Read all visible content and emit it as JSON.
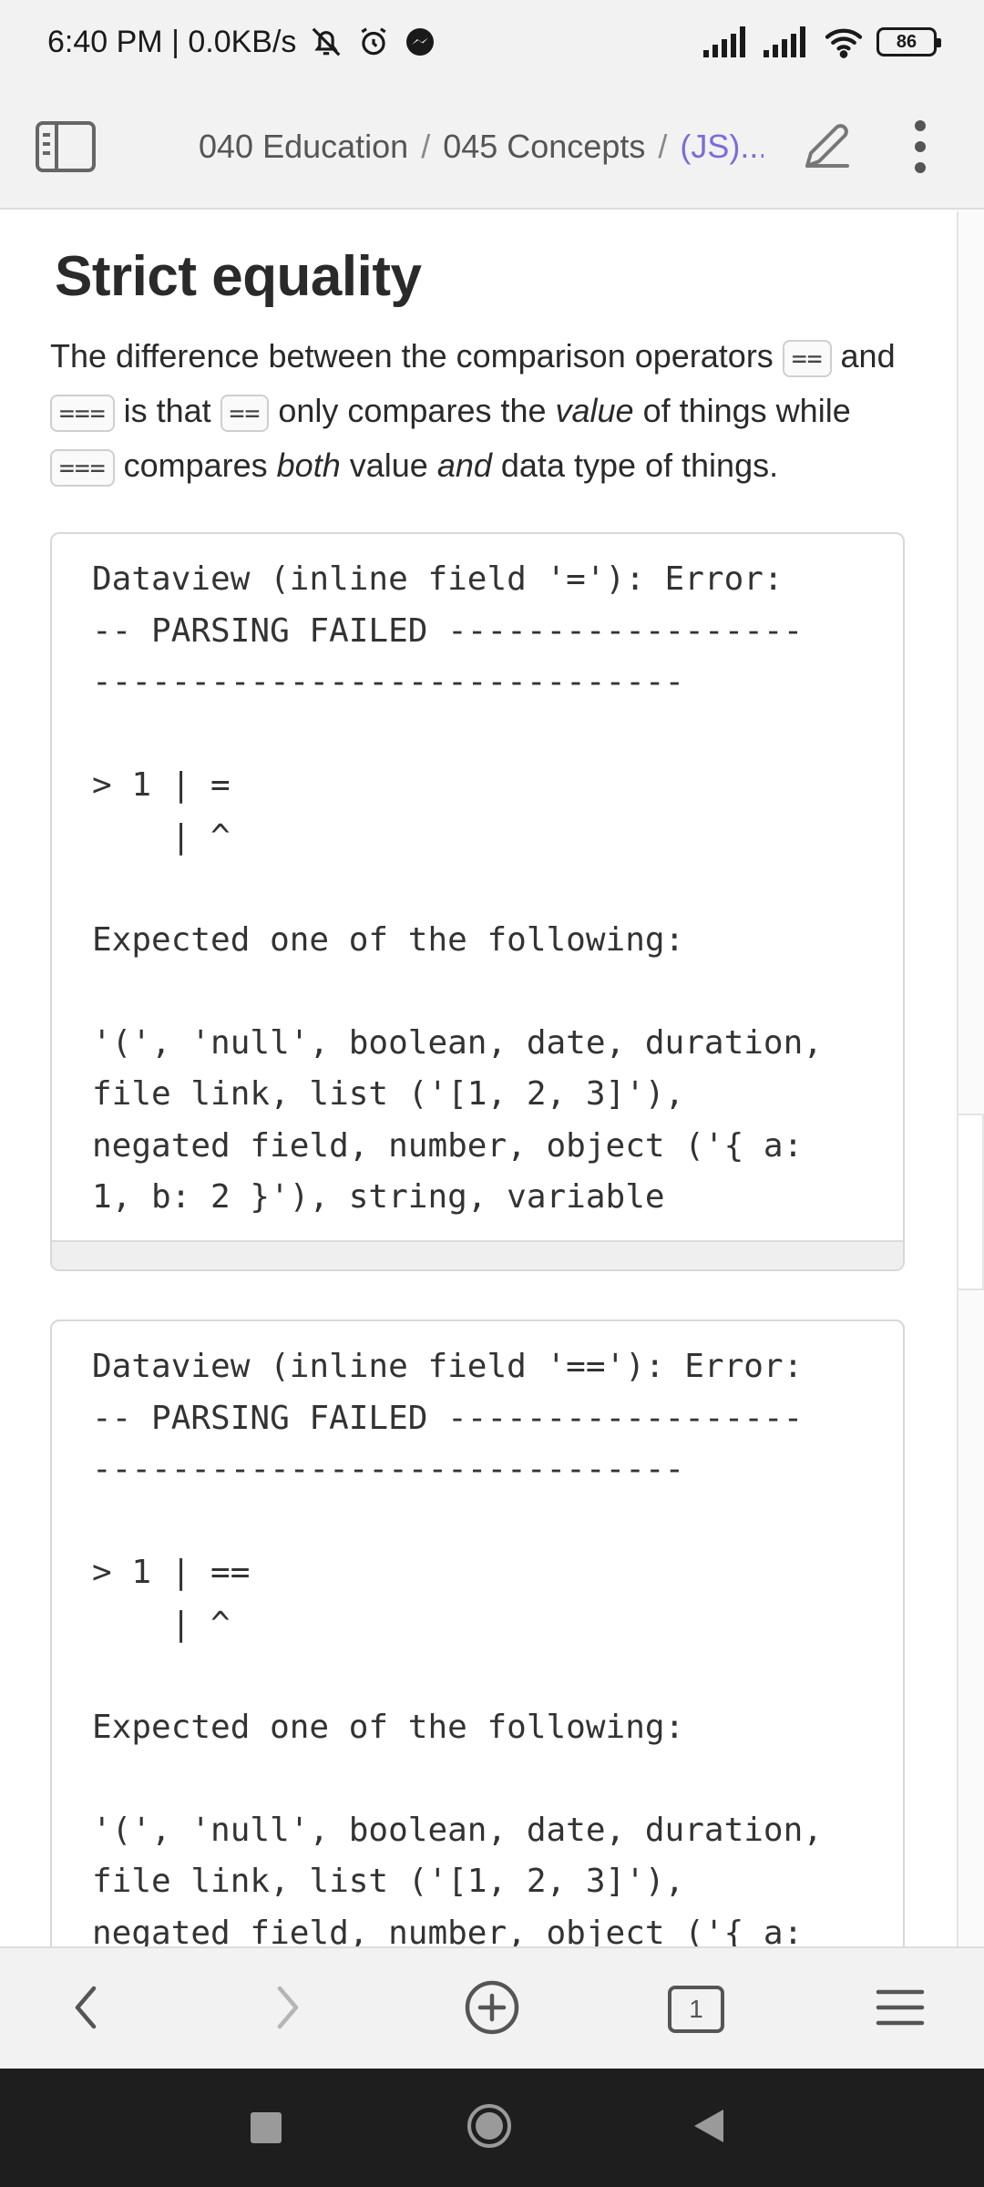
{
  "status_bar": {
    "time_speed": "6:40 PM | 0.0KB/s",
    "battery": "86"
  },
  "header": {
    "breadcrumb": [
      "040 Education",
      "045 Concepts",
      "(JS)..."
    ],
    "separator": "/"
  },
  "note": {
    "title": "Strict equality",
    "paragraph": {
      "t1": "The difference between the comparison operators ",
      "c1": "==",
      "t2": " and ",
      "c2": "===",
      "t3": " is that ",
      "c3": "==",
      "t4": " only compares the ",
      "em1": "value",
      "t5": " of things while ",
      "c4": "===",
      "t6": " compares ",
      "em2": "both",
      "t7": " value ",
      "em3": "and",
      "t8": " data type of things."
    },
    "dataview_errors": [
      {
        "text": "Dataview (inline field '='): Error:\n-- PARSING FAILED ------------------\n------------------------------\n\n> 1 | =\n    | ^\n\nExpected one of the following:\n\n'(', 'null', boolean, date, duration,\nfile link, list ('[1, 2, 3]'),\nnegated field, number, object ('{ a:\n1, b: 2 }'), string, variable"
      },
      {
        "text": "Dataview (inline field '=='): Error:\n-- PARSING FAILED ------------------\n------------------------------\n\n> 1 | ==\n    | ^\n\nExpected one of the following:\n\n'(', 'null', boolean, date, duration,\nfile link, list ('[1, 2, 3]'),\nnegated field, number, object ('{ a:"
      }
    ]
  },
  "bottom_toolbar": {
    "tab_count": "1"
  },
  "icons": {
    "sidebar_toggle": "sidebar-icon",
    "edit": "pencil-icon",
    "more": "more-vertical-icon",
    "back": "chevron-left-icon",
    "forward": "chevron-right-icon",
    "new_tab": "plus-circle-icon",
    "tabs": "tabs-icon",
    "menu": "hamburger-menu-icon"
  },
  "colors": {
    "accent": "#7b6cd9",
    "chrome_bg": "#f2f2f2",
    "nav_bg": "#1e1e1e"
  }
}
